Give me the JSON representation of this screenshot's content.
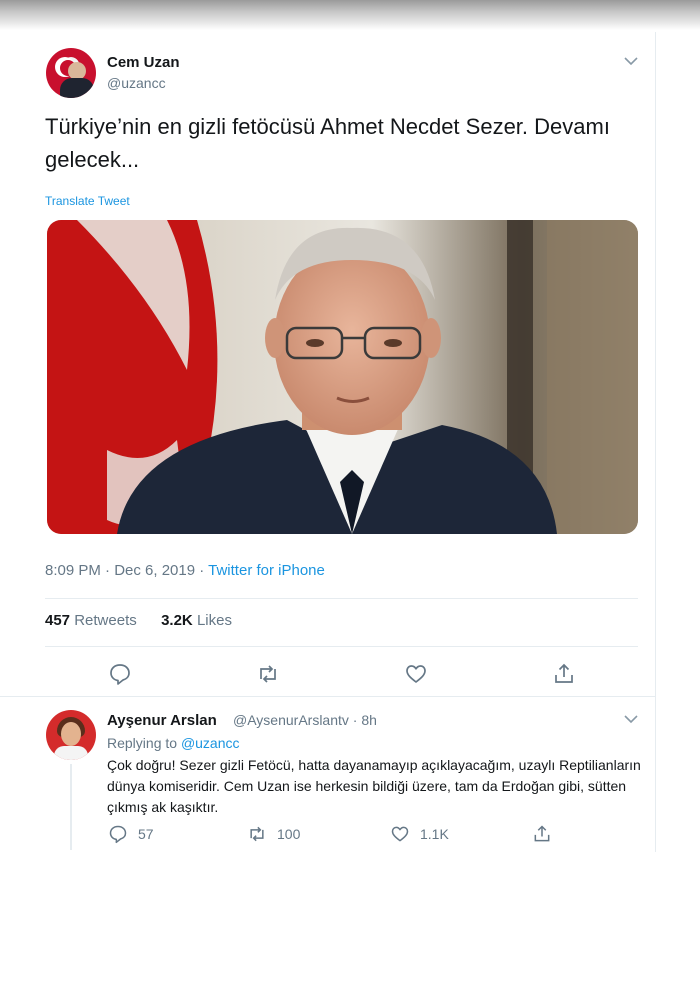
{
  "tweet": {
    "author_name": "Cem Uzan",
    "author_handle": "@uzancc",
    "text": "Türkiye’nin en gizli fetöcüsü Ahmet Necdet Sezer. Devamı gelecek...",
    "translate_label": "Translate Tweet",
    "time": "8:09 PM · Dec 6, 2019 · ",
    "source": "Twitter for iPhone",
    "retweets_count": "457",
    "retweets_label": "Retweets",
    "likes_count": "3.2K",
    "likes_label": "Likes",
    "icons": [
      "reply-icon",
      "retweet-icon",
      "like-icon",
      "share-icon"
    ]
  },
  "reply": {
    "author_name": "Ayşenur Arslan",
    "author_handle": "@AysenurArslantv · 8h",
    "replying_prefix": "Replying to ",
    "replying_to": "@uzancc",
    "text": "Çok doğru! Sezer gizli Fetöcü, hatta dayanamayıp açıklayacağım, uzaylı Reptilianların dünya komiseridir. Cem Uzan ise herkesin bildiği üzere, tam da Erdoğan gibi, sütten çıkmış ak kaşıktır.",
    "reply_count": "57",
    "retweet_count": "100",
    "like_count": "1.1K"
  },
  "colors": {
    "link": "#1b95e0",
    "secondary_text": "#657786",
    "flag_red": "#c8102e"
  }
}
